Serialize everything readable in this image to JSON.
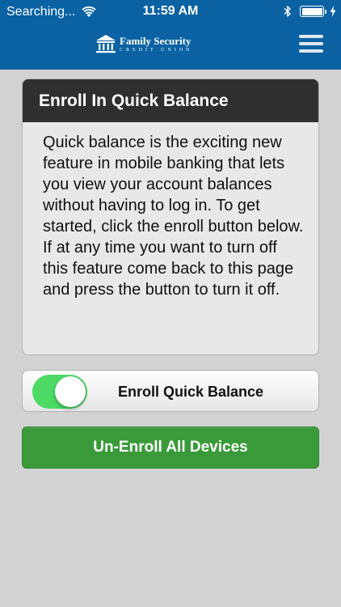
{
  "status_bar": {
    "carrier": "Searching...",
    "time": "11:59 AM",
    "wifi_icon": "wifi-icon",
    "bluetooth_icon": "bluetooth-icon",
    "battery_icon": "battery-icon",
    "charging_icon": "charging-bolt-icon",
    "battery_level": 1.0
  },
  "nav": {
    "logo_name": "Family Security",
    "logo_sub": "CREDIT UNION",
    "menu_icon": "hamburger-menu-icon"
  },
  "card": {
    "title": "Enroll In Quick Balance",
    "body": "Quick balance is the exciting new feature in mobile banking that lets you view your account balances without having to log in. To get started, click the enroll button below. If at any time you want to turn off this feature come back to this page and press the button to turn it off."
  },
  "enroll": {
    "label": "Enroll Quick Balance",
    "toggle_on": true
  },
  "unenroll": {
    "label": "Un-Enroll All Devices"
  },
  "colors": {
    "header_bg": "#0a62a3",
    "page_bg": "#d2d2d2",
    "card_header_bg": "#2f2f2f",
    "toggle_on": "#4cd964",
    "button_green": "#3a9a3a"
  }
}
